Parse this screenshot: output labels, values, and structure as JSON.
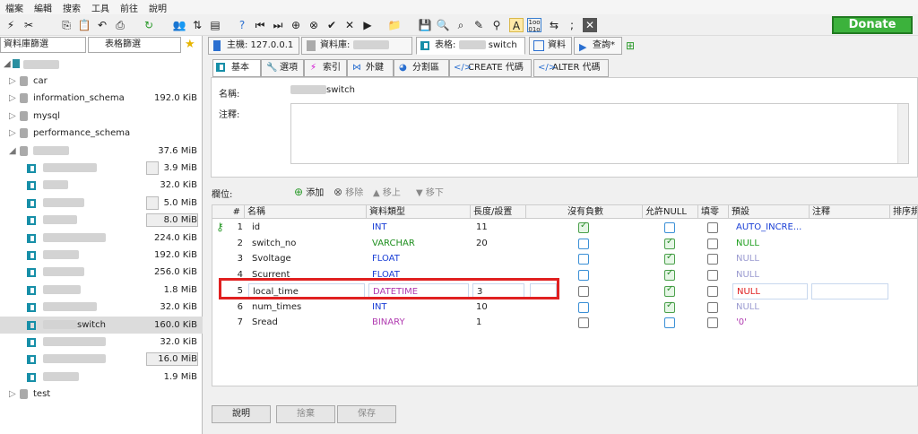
{
  "menu": [
    "檔案",
    "編輯",
    "搜索",
    "工具",
    "前往",
    "說明"
  ],
  "donate": "Donate",
  "left": {
    "filter_db": "資料庫篩選",
    "filter_table": "表格篩選",
    "items": [
      {
        "name": "car",
        "size": ""
      },
      {
        "name": "information_schema",
        "size": "192.0 KiB"
      },
      {
        "name": "mysql",
        "size": ""
      },
      {
        "name": "performance_schema",
        "size": ""
      },
      {
        "name": "",
        "size": "37.6 MiB"
      },
      {
        "name": "",
        "size": "3.9 MiB"
      },
      {
        "name": "",
        "size": "32.0 KiB"
      },
      {
        "name": "",
        "size": "5.0 MiB"
      },
      {
        "name": "",
        "size": "8.0 MiB"
      },
      {
        "name": "",
        "size": "224.0 KiB"
      },
      {
        "name": "",
        "size": "192.0 KiB"
      },
      {
        "name": "",
        "size": "256.0 KiB"
      },
      {
        "name": "",
        "size": "1.8 MiB"
      },
      {
        "name": "",
        "size": "32.0 KiB"
      },
      {
        "name": "switch",
        "size": "160.0 KiB"
      },
      {
        "name": "",
        "size": "32.0 KiB"
      },
      {
        "name": "",
        "size": "16.0 MiB"
      },
      {
        "name": "",
        "size": "1.9 MiB"
      },
      {
        "name": "test",
        "size": ""
      }
    ]
  },
  "tabs": {
    "host": "主機: 127.0.0.1",
    "database": "資料庫:",
    "table": "表格:",
    "table_suffix": "switch",
    "data": "資料",
    "query": "查詢*"
  },
  "subtabs": [
    "基本",
    "選項",
    "索引",
    "外鍵",
    "分割區",
    "CREATE 代碼",
    "ALTER 代碼"
  ],
  "form": {
    "name_label": "名稱:",
    "name_value": "switch",
    "comment_label": "注釋:"
  },
  "columns_bar": {
    "label": "欄位:",
    "add": "添加",
    "remove": "移除",
    "up": "移上",
    "down": "移下"
  },
  "grid": {
    "headers": [
      "#",
      "名稱",
      "資料類型",
      "長度/設置",
      "沒有負數",
      "允許NULL",
      "填零",
      "預設",
      "注釋",
      "排序規"
    ],
    "rows": [
      {
        "num": "1",
        "name": "id",
        "type": "INT",
        "len": "11",
        "unsigned": true,
        "nullable": false,
        "zerofill": false,
        "default": "AUTO_INCRE..."
      },
      {
        "num": "2",
        "name": "switch_no",
        "type": "VARCHAR",
        "len": "20",
        "unsigned": false,
        "nullable": true,
        "zerofill": false,
        "default": "NULL"
      },
      {
        "num": "3",
        "name": "Svoltage",
        "type": "FLOAT",
        "len": "",
        "unsigned": false,
        "nullable": true,
        "zerofill": false,
        "default": "NULL"
      },
      {
        "num": "4",
        "name": "Scurrent",
        "type": "FLOAT",
        "len": "",
        "unsigned": false,
        "nullable": true,
        "zerofill": false,
        "default": "NULL"
      },
      {
        "num": "5",
        "name": "local_time",
        "type": "DATETIME",
        "len": "3",
        "unsigned": false,
        "nullable": true,
        "zerofill": false,
        "default": "NULL"
      },
      {
        "num": "6",
        "name": "num_times",
        "type": "INT",
        "len": "10",
        "unsigned": false,
        "nullable": true,
        "zerofill": false,
        "default": "NULL"
      },
      {
        "num": "7",
        "name": "Sread",
        "type": "BINARY",
        "len": "1",
        "unsigned": false,
        "nullable": false,
        "zerofill": false,
        "default": "'0'"
      }
    ]
  },
  "buttons": {
    "help": "說明",
    "discard": "捨棄",
    "save": "保存"
  },
  "colors": {
    "type_blue": "#1a3fd6",
    "type_purple": "#b03bb0",
    "type_green": "#1f8f1f",
    "default_green": "#1f9f1f",
    "highlight": "#e02020"
  }
}
